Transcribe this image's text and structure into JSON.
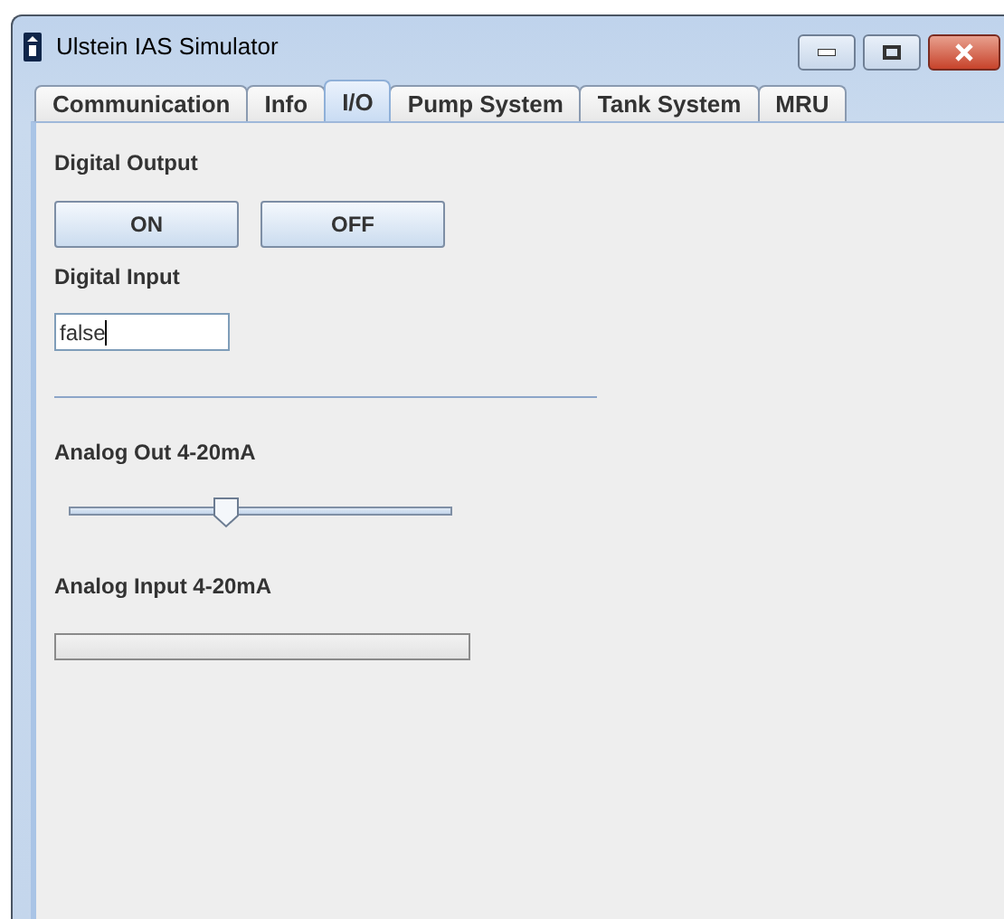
{
  "window": {
    "title": "Ulstein IAS Simulator"
  },
  "tabs": [
    {
      "label": "Communication",
      "selected": false
    },
    {
      "label": "Info",
      "selected": false
    },
    {
      "label": "I/O",
      "selected": true
    },
    {
      "label": "Pump System",
      "selected": false
    },
    {
      "label": "Tank System",
      "selected": false
    },
    {
      "label": "MRU",
      "selected": false
    }
  ],
  "digital_output": {
    "label": "Digital Output",
    "buttons": [
      "ON",
      "OFF"
    ]
  },
  "digital_input": {
    "label": "Digital Input",
    "value": "false"
  },
  "analog_out": {
    "label": "Analog Out 4-20mA",
    "level": 0.41
  },
  "analog_input": {
    "label": "Analog Input 4-20mA",
    "level": 0
  }
}
